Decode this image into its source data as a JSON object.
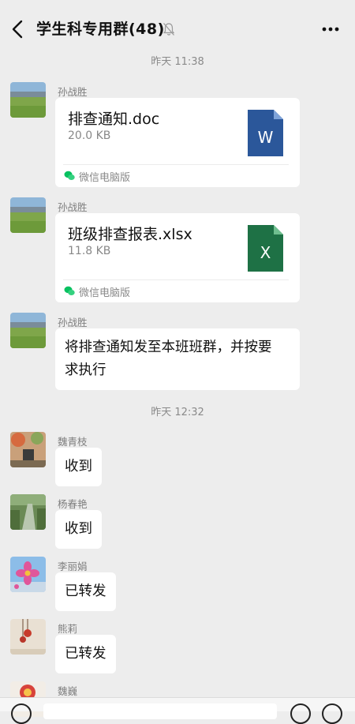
{
  "header": {
    "title": "学生科专用群(48)"
  },
  "timestamps": [
    "昨天 11:38",
    "昨天 12:32"
  ],
  "messages": [
    {
      "sender": "孙战胜",
      "type": "file",
      "file_name": "排查通知.doc",
      "file_size": "20.0 KB",
      "source": "微信电脑版",
      "file_icon": "word-doc-icon",
      "icon_letter": "W",
      "icon_color": "#2b579a"
    },
    {
      "sender": "孙战胜",
      "type": "file",
      "file_name": "班级排查报表.xlsx",
      "file_size": "11.8 KB",
      "source": "微信电脑版",
      "file_icon": "excel-xlsx-icon",
      "icon_letter": "X",
      "icon_color": "#1e7145"
    },
    {
      "sender": "孙战胜",
      "type": "text",
      "text_line1": "将排查通知发至本班班群，并按要",
      "text_line2": "求执行"
    },
    {
      "sender": "魏青枝",
      "type": "text",
      "text": "收到"
    },
    {
      "sender": "杨春艳",
      "type": "text",
      "text": "收到"
    },
    {
      "sender": "李丽娟",
      "type": "text",
      "text": "已转发"
    },
    {
      "sender": "熊莉",
      "type": "text",
      "text": "已转发"
    },
    {
      "sender": "魏巍",
      "type": "text",
      "text": ""
    }
  ],
  "colors": {
    "background": "#ededed",
    "bubble": "#ffffff",
    "wechat_green": "#07c160"
  }
}
